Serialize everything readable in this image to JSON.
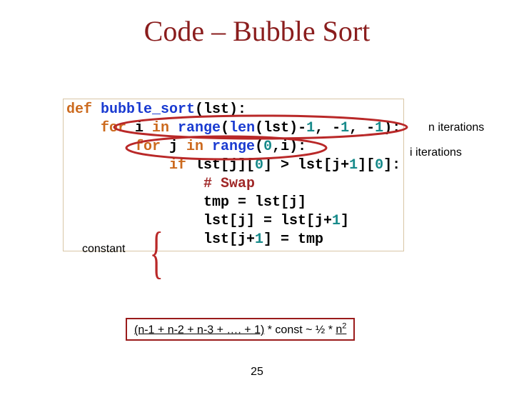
{
  "title": "Code – Bubble Sort",
  "code": {
    "l1a": "def ",
    "l1b": "bubble_sort",
    "l1c": "(lst):",
    "l2a": "for ",
    "l2b": "i ",
    "l2c": "in ",
    "l2d": "range",
    "l2e": "(",
    "l2f": "len",
    "l2g": "(lst)-",
    "l2h": "1",
    "l2i": ", -",
    "l2j": "1",
    "l2k": ", -",
    "l2l": "1",
    "l2m": "):",
    "l3a": "for ",
    "l3b": "j ",
    "l3c": "in ",
    "l3d": "range",
    "l3e": "(",
    "l3f": "0",
    "l3g": ",i):",
    "l4a": "if ",
    "l4b": "lst[j][",
    "l4c": "0",
    "l4d": "] > lst[j+",
    "l4e": "1",
    "l4f": "][",
    "l4g": "0",
    "l4h": "]:",
    "l5": "# Swap",
    "l6": "tmp = lst[j]",
    "l7a": "lst[j] = lst[j+",
    "l7b": "1",
    "l7c": "]",
    "l8a": "lst[j+",
    "l8b": "1",
    "l8c": "] = tmp"
  },
  "annotations": {
    "constant": "constant",
    "n_iter": "n iterations",
    "i_iter": "i iterations"
  },
  "complexity": {
    "underlined": "(n-1 + n-2 + n-3 + …. + 1)",
    "mid": " * const  ~ ½ * ",
    "n": "n",
    "exp": "2"
  },
  "page": "25"
}
